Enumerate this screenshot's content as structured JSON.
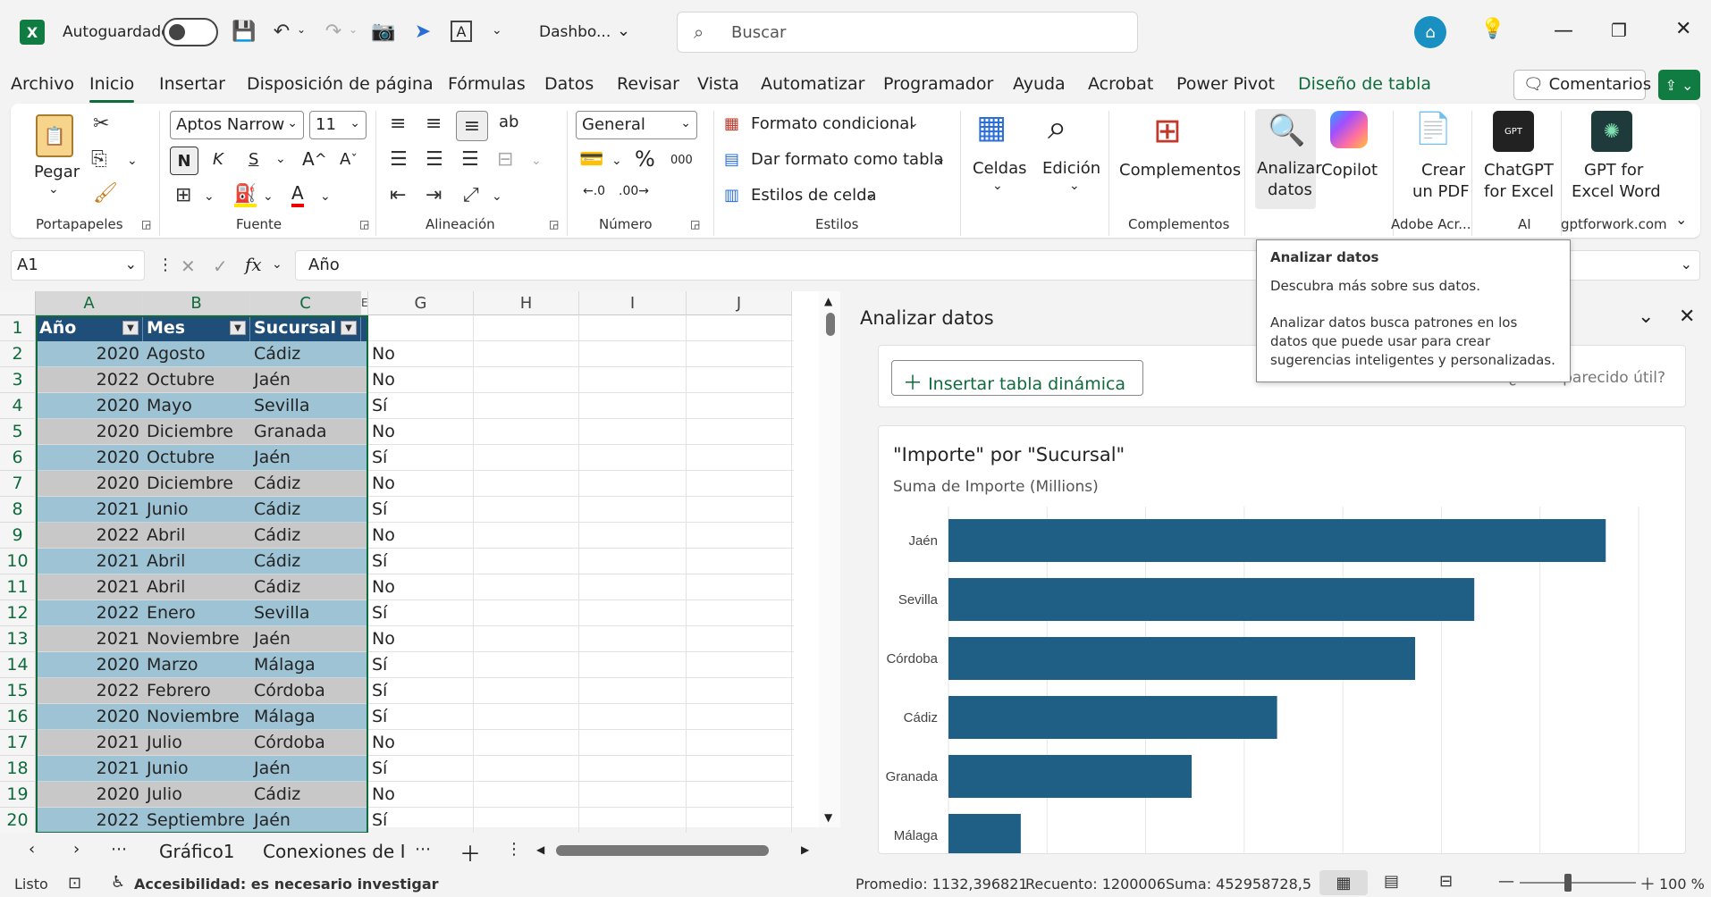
{
  "titlebar": {
    "autosave_label": "Autoguardado",
    "filename": "Dashbo...",
    "search_placeholder": "Buscar"
  },
  "menu": {
    "tabs": [
      "Archivo",
      "Inicio",
      "Insertar",
      "Disposición de página",
      "Fórmulas",
      "Datos",
      "Revisar",
      "Vista",
      "Automatizar",
      "Programador",
      "Ayuda",
      "Acrobat",
      "Power Pivot",
      "Diseño de tabla"
    ],
    "comments_button": "Comentarios"
  },
  "ribbon": {
    "paste_label": "Pegar",
    "group_portapapeles": "Portapapeles",
    "font_name": "Aptos Narrow",
    "font_size": "11",
    "group_fuente": "Fuente",
    "group_alineacion": "Alineación",
    "number_format": "General",
    "group_numero": "Número",
    "cond_format": "Formato condicional",
    "table_format": "Dar formato como tabla",
    "cell_styles": "Estilos de celda",
    "group_estilos": "Estilos",
    "celdas": "Celdas",
    "edicion": "Edición",
    "complementos_btn": "Complementos",
    "group_complementos": "Complementos",
    "analizar_l1": "Analizar",
    "analizar_l2": "datos",
    "copilot": "Copilot",
    "crear_l1": "Crear",
    "crear_l2": "un PDF",
    "group_adobe": "Adobe Acr...",
    "chatgpt_l1": "ChatGPT",
    "chatgpt_l2": "for Excel",
    "group_ai": "AI",
    "gptword_l1": "GPT for",
    "gptword_l2": "Excel Word",
    "group_gptforwork": "gptforwork.com"
  },
  "formula_bar": {
    "name_box": "A1",
    "fx": "fx",
    "content": "Año"
  },
  "grid": {
    "columns": [
      "A",
      "B",
      "C",
      "E",
      "G",
      "H",
      "I",
      "J"
    ],
    "headers": [
      "Año",
      "Mes",
      "Sucursal"
    ],
    "row_numbers": [
      "1",
      "2",
      "3",
      "4",
      "5",
      "6",
      "7",
      "8",
      "9",
      "10",
      "11",
      "12",
      "13",
      "14",
      "15",
      "16",
      "17",
      "18",
      "19",
      "20"
    ],
    "rows": [
      [
        "2020",
        "Agosto",
        "Cádiz",
        "No"
      ],
      [
        "2022",
        "Octubre",
        "Jaén",
        "No"
      ],
      [
        "2020",
        "Mayo",
        "Sevilla",
        "Sí"
      ],
      [
        "2020",
        "Diciembre",
        "Granada",
        "No"
      ],
      [
        "2020",
        "Octubre",
        "Jaén",
        "Sí"
      ],
      [
        "2020",
        "Diciembre",
        "Cádiz",
        "No"
      ],
      [
        "2021",
        "Junio",
        "Cádiz",
        "Sí"
      ],
      [
        "2022",
        "Abril",
        "Cádiz",
        "No"
      ],
      [
        "2021",
        "Abril",
        "Cádiz",
        "Sí"
      ],
      [
        "2021",
        "Abril",
        "Cádiz",
        "No"
      ],
      [
        "2022",
        "Enero",
        "Sevilla",
        "Sí"
      ],
      [
        "2021",
        "Noviembre",
        "Jaén",
        "No"
      ],
      [
        "2020",
        "Marzo",
        "Málaga",
        "Sí"
      ],
      [
        "2022",
        "Febrero",
        "Córdoba",
        "Sí"
      ],
      [
        "2020",
        "Noviembre",
        "Málaga",
        "Sí"
      ],
      [
        "2021",
        "Julio",
        "Córdoba",
        "No"
      ],
      [
        "2021",
        "Junio",
        "Jaén",
        "Sí"
      ],
      [
        "2020",
        "Julio",
        "Cádiz",
        "No"
      ],
      [
        "2022",
        "Septiembre",
        "Jaén",
        "Sí"
      ]
    ],
    "header_bg": "#1f4e79",
    "row_band_1": "#9dc3d4",
    "row_band_2": "#c8c8c8"
  },
  "pane": {
    "title": "Analizar datos",
    "insert_pivot": "Insertar tabla dinámica",
    "feedback": "¿Le ha parecido útil?",
    "tooltip_title": "Analizar datos",
    "tooltip_line1": "Descubra más sobre sus datos.",
    "tooltip_line2": "Analizar datos busca patrones en los datos que puede usar para crear sugerencias inteligentes y personalizadas."
  },
  "chart_data": {
    "type": "bar",
    "orientation": "horizontal",
    "title": "\"Importe\" por \"Sucursal\"",
    "subtitle": "Suma de Importe (Millions)",
    "categories": [
      "Jaén",
      "Sevilla",
      "Córdoba",
      "Cádiz",
      "Granada",
      "Málaga"
    ],
    "values": [
      100,
      80,
      71,
      50,
      37,
      11
    ],
    "xlim": [
      0,
      105
    ],
    "bar_color": "#1f5f86",
    "grid": true
  },
  "sheets": {
    "tabs": [
      "Gráfico1",
      "Conexiones de In"
    ]
  },
  "status": {
    "ready": "Listo",
    "accessibility": "Accesibilidad: es necesario investigar",
    "average": "Promedio: 1132,396821",
    "count": "Recuento: 1200006",
    "sum": "Suma: 452958728,5",
    "zoom": "100 %"
  }
}
